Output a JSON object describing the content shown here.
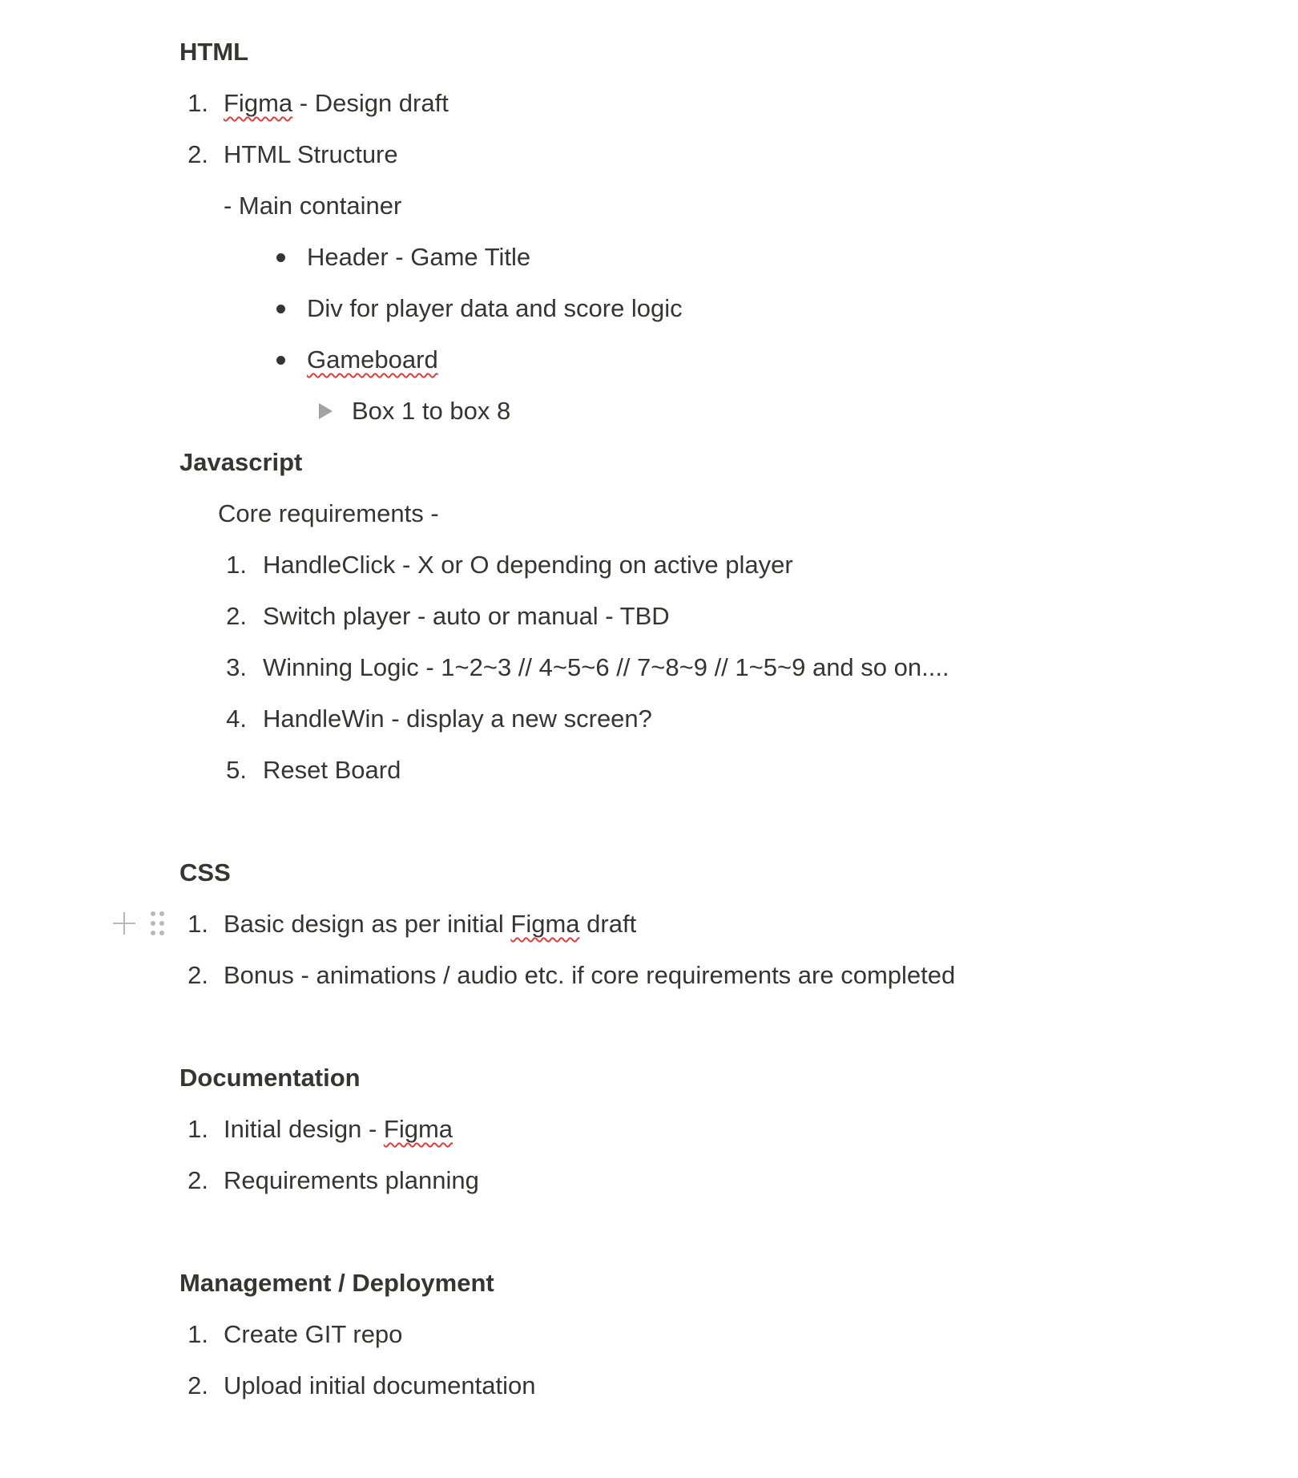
{
  "sections": {
    "html": {
      "heading": "HTML",
      "items": {
        "n1": "1.",
        "t1_a": "Figma",
        "t1_b": " - Design draft",
        "n2": "2.",
        "t2": "HTML Structure",
        "sub": "- Main container",
        "b1": "Header - Game Title",
        "b2": "Div for player data and score logic",
        "b3": "Gameboard",
        "toggle": "Box 1 to box 8"
      }
    },
    "js": {
      "heading": "Javascript",
      "intro": "Core requirements -",
      "items": [
        {
          "n": "1.",
          "t": "HandleClick - X or O depending on active player"
        },
        {
          "n": "2.",
          "t": "Switch player - auto or manual - TBD"
        },
        {
          "n": "3.",
          "t": "Winning Logic - 1~2~3 // 4~5~6 // 7~8~9 // 1~5~9 and so on...."
        },
        {
          "n": "4.",
          "t": "HandleWin - display a new screen?"
        },
        {
          "n": "5.",
          "t": "Reset Board"
        }
      ]
    },
    "css": {
      "heading": "CSS",
      "n1": "1.",
      "t1_a": "Basic design as per initial ",
      "t1_b": "Figma",
      "t1_c": " draft",
      "n2": "2.",
      "t2": "Bonus - animations / audio etc. if core requirements are completed"
    },
    "docs": {
      "heading": "Documentation",
      "n1": "1.",
      "t1_a": "Initial design - ",
      "t1_b": "Figma",
      "n2": "2.",
      "t2": "Requirements planning"
    },
    "mgmt": {
      "heading": "Management / Deployment",
      "n1": "1.",
      "t1": "Create GIT repo",
      "n2": "2.",
      "t2": "Upload initial documentation"
    }
  },
  "icons": {
    "add_block": "plus-icon",
    "drag_handle": "drag-handle-icon",
    "toggle": "triangle-right-icon",
    "bullet": "bullet-dot-icon"
  },
  "colors": {
    "text": "#37352f",
    "muted_icon": "#b9b8b5",
    "toggle_icon": "#a3a29f",
    "spellcheck": "#e03e3e"
  }
}
